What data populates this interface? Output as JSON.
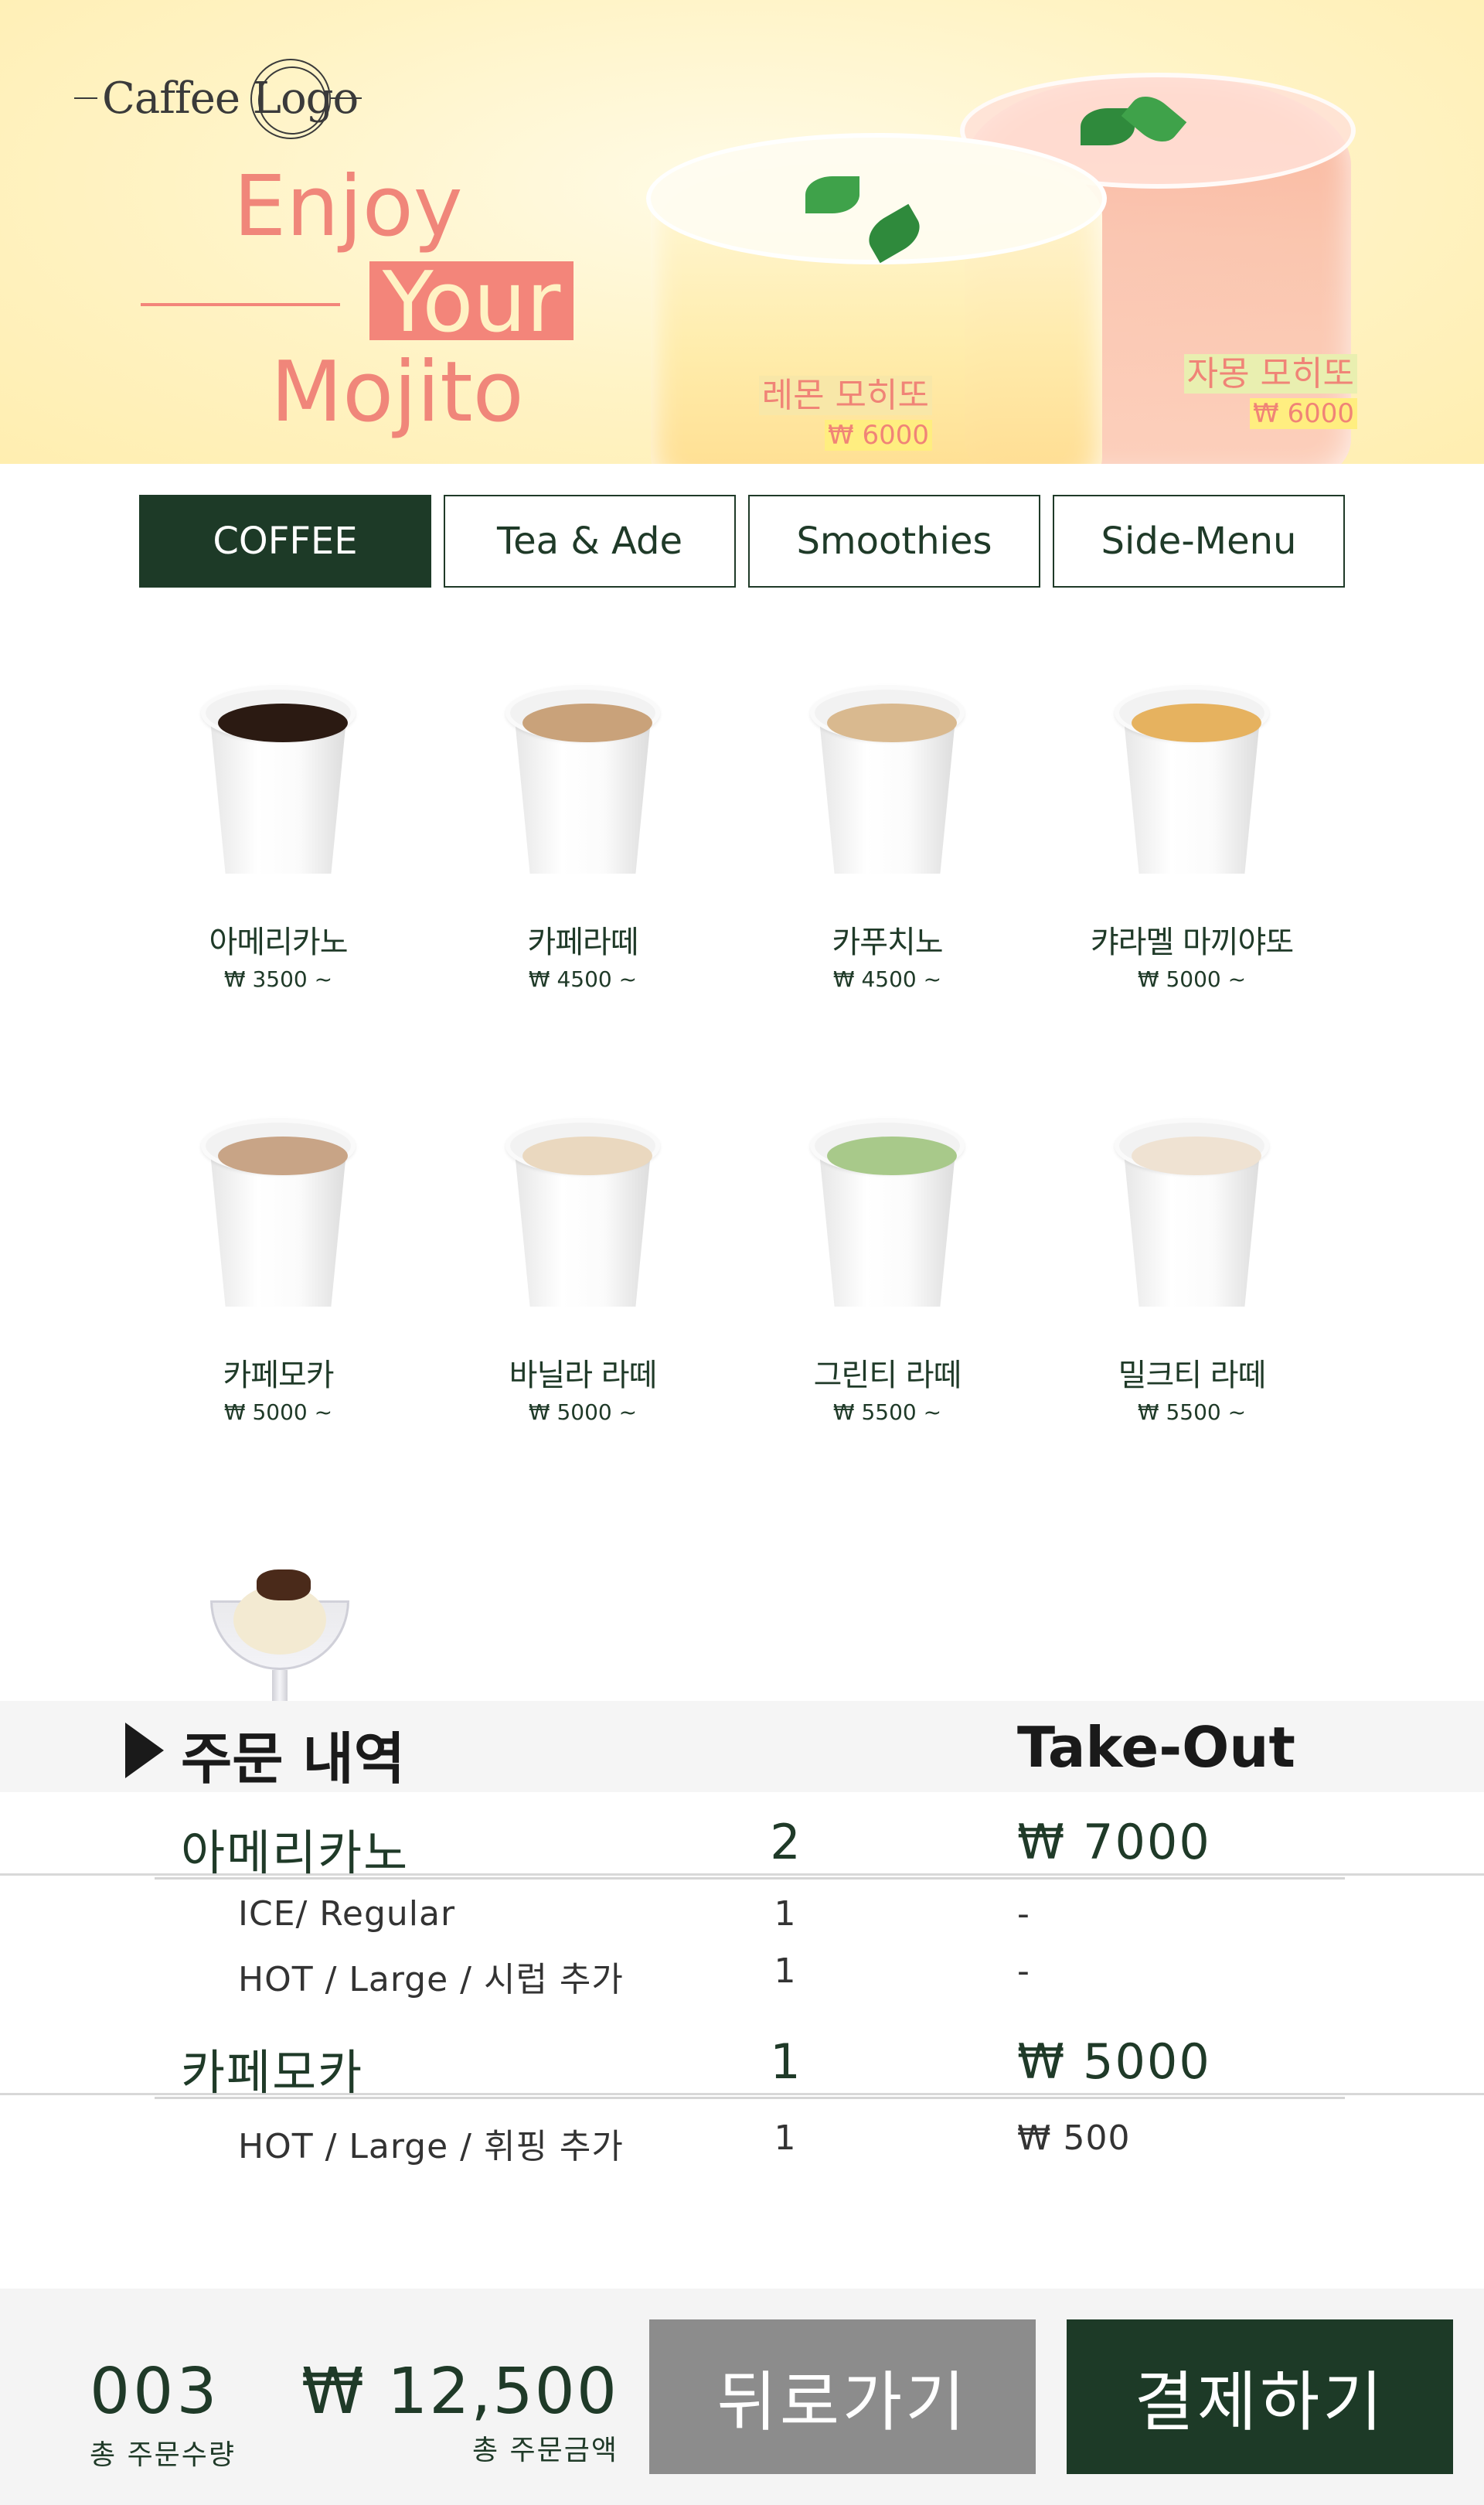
{
  "brand": {
    "logo_text": "Caffee Logo"
  },
  "hero": {
    "slogan_1": "Enjoy",
    "slogan_2": "Your",
    "slogan_3": "Mojito",
    "drinks": [
      {
        "name": "레몬 모히또",
        "price": "₩ 6000"
      },
      {
        "name": "자몽 모히또",
        "price": "₩ 6000"
      }
    ]
  },
  "tabs": [
    {
      "label": "COFFEE",
      "active": true
    },
    {
      "label": "Tea & Ade",
      "active": false
    },
    {
      "label": "Smoothies",
      "active": false
    },
    {
      "label": "Side-Menu",
      "active": false
    }
  ],
  "menu": [
    {
      "name": "아메리카노",
      "price": "₩ 3500 ~",
      "color": "#2b1a12"
    },
    {
      "name": "카페라떼",
      "price": "₩ 4500 ~",
      "color": "#c9a27a"
    },
    {
      "name": "카푸치노",
      "price": "₩ 4500 ~",
      "color": "#d9b98f"
    },
    {
      "name": "캬라멜 마끼야또",
      "price": "₩ 5000 ~",
      "color": "#e6b25f"
    },
    {
      "name": "카페모카",
      "price": "₩ 5000 ~",
      "color": "#c8a486"
    },
    {
      "name": "바닐라 라떼",
      "price": "₩ 5000 ~",
      "color": "#ead8bf"
    },
    {
      "name": "그린티 라떼",
      "price": "₩ 5500 ~",
      "color": "#a8c98a"
    },
    {
      "name": "밀크티 라떼",
      "price": "₩ 5500 ~",
      "color": "#efe2d2"
    }
  ],
  "order": {
    "title": "주문 내역",
    "mode": "Take-Out",
    "items": [
      {
        "name": "아메리카노",
        "qty": "2",
        "price": "₩ 7000",
        "options": [
          {
            "label": "ICE/ Regular",
            "qty": "1",
            "price": "-"
          },
          {
            "label": "HOT / Large / 시럽 추가",
            "qty": "1",
            "price": "-"
          }
        ]
      },
      {
        "name": "카페모카",
        "qty": "1",
        "price": "₩ 5000",
        "options": [
          {
            "label": "HOT / Large / 휘핑 추가",
            "qty": "1",
            "price": "₩ 500"
          }
        ]
      }
    ]
  },
  "footer": {
    "count": "003",
    "count_label": "총 주문수량",
    "total": "₩ 12,500",
    "total_label": "총 주문금액",
    "back_label": "뒤로가기",
    "pay_label": "결제하기"
  },
  "colors": {
    "accent": "#1d3a27",
    "brand_pink": "#f3857a",
    "back_gray": "#8c8c8c"
  }
}
